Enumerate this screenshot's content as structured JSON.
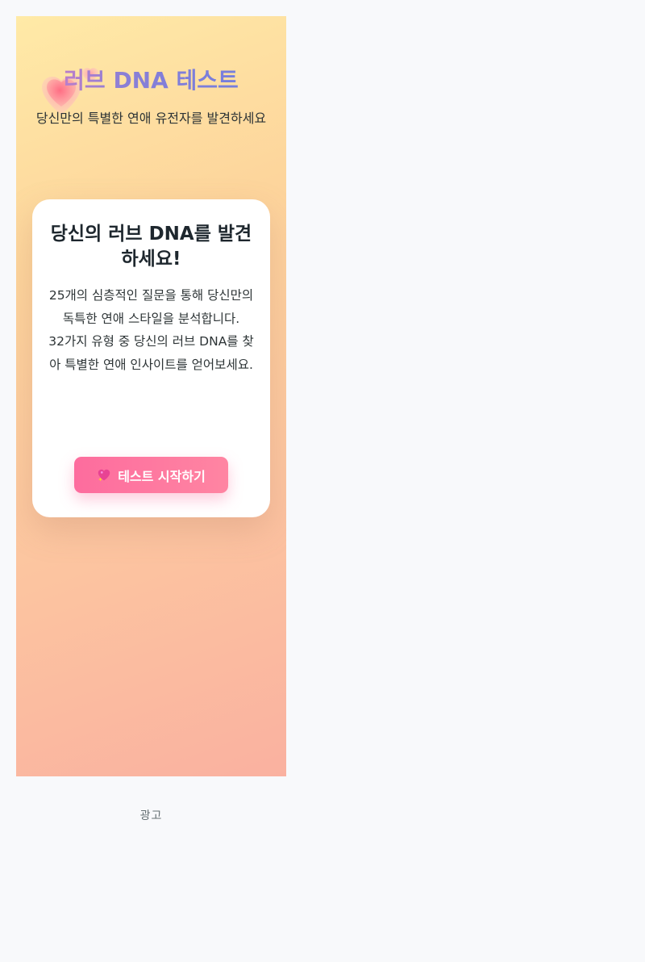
{
  "header": {
    "title": "러브 DNA 테스트",
    "subtitle": "당신만의 특별한 연애 유전자를 발견하세요"
  },
  "card": {
    "title": "당신의 러브 DNA를 발견하세요!",
    "description": "25개의 심층적인 질문을 통해 당신만의 독특한 연애 스타일을 분석합니다.\n32가지 유형 중 당신의 러브 DNA를 찾아 특별한 연애 인사이트를 얻어보세요.",
    "start_button": {
      "icon": "sparkling-heart-icon",
      "label": "테스트 시작하기"
    }
  },
  "ad": {
    "label": "광고"
  },
  "colors": {
    "accent_pink": "#fd6c9e",
    "title_gradient_start": "#e17ec1",
    "title_gradient_end": "#6c7de0",
    "background_gradient_start": "#ffeaa7",
    "background_gradient_end": "#fab1a0"
  }
}
